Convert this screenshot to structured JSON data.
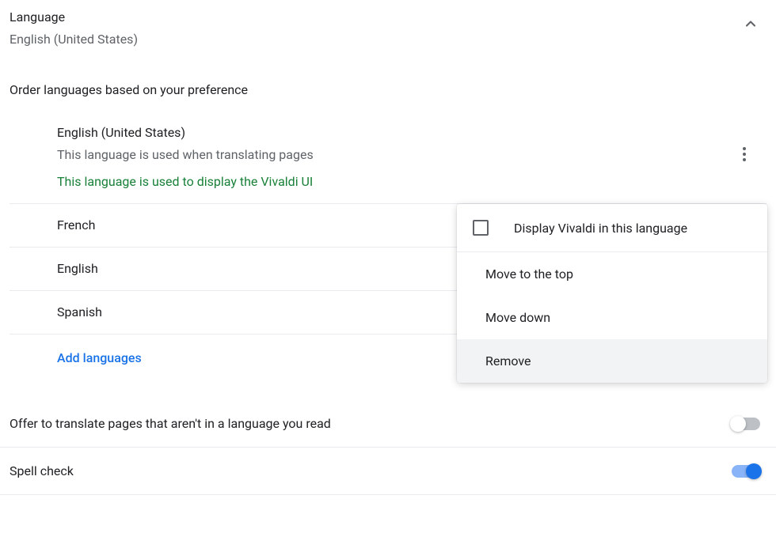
{
  "header": {
    "title": "Language",
    "selected": "English (United States)"
  },
  "order_description": "Order languages based on your preference",
  "languages": [
    {
      "name": "English (United States)",
      "description": "This language is used when translating pages",
      "ui_note": "This language is used to display the Vivaldi UI"
    },
    {
      "name": "French"
    },
    {
      "name": "English"
    },
    {
      "name": "Spanish"
    }
  ],
  "add_languages_label": "Add languages",
  "settings": {
    "translate_offer": {
      "label": "Offer to translate pages that aren't in a language you read",
      "enabled": false
    },
    "spell_check": {
      "label": "Spell check",
      "enabled": true
    }
  },
  "context_menu": {
    "display_in_language": "Display Vivaldi in this language",
    "move_top": "Move to the top",
    "move_down": "Move down",
    "remove": "Remove"
  }
}
